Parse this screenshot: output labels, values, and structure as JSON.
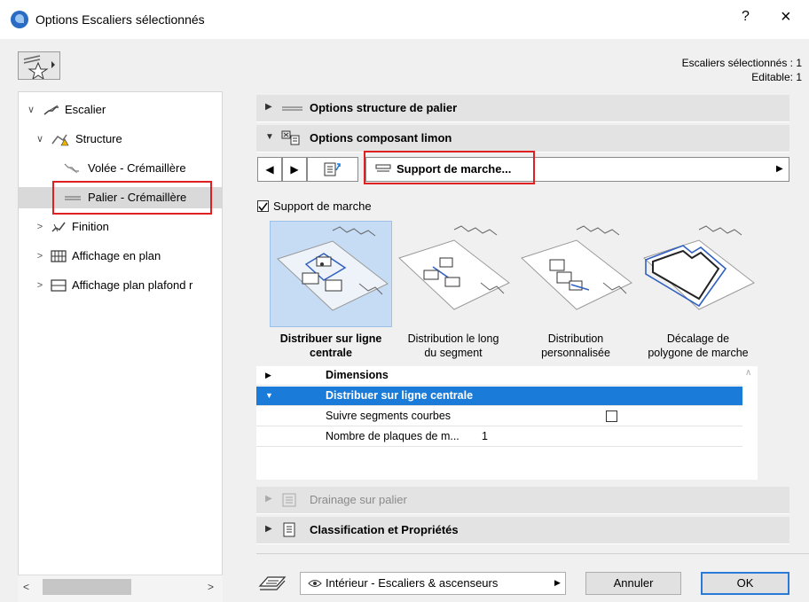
{
  "window": {
    "title": "Options Escaliers sélectionnés",
    "help": "?",
    "close": "×"
  },
  "status": {
    "selected": "Escaliers sélectionnés : 1",
    "editable": "Editable: 1"
  },
  "tree": {
    "items": [
      {
        "label": "Escalier",
        "twisty": "∨"
      },
      {
        "label": "Structure",
        "twisty": "∨"
      },
      {
        "label": "Volée - Crémaillère"
      },
      {
        "label": "Palier - Crémaillère"
      },
      {
        "label": "Finition",
        "twisty": ">"
      },
      {
        "label": "Affichage en plan",
        "twisty": ">"
      },
      {
        "label": "Affichage plan plafond r",
        "twisty": ">"
      }
    ]
  },
  "sections": {
    "structure": "Options structure de palier",
    "composant": "Options composant limon",
    "drainage": "Drainage sur palier",
    "classification": "Classification et Propriétés"
  },
  "nav": {
    "prev": "◀",
    "next": "▶",
    "field": "Support de marche..."
  },
  "support": {
    "checkbox_label": "Support de marche",
    "checked": true,
    "options": [
      {
        "label_line1": "Distribuer sur ligne",
        "label_line2": "centrale",
        "selected": true
      },
      {
        "label_line1": "Distribution le long",
        "label_line2": "du segment",
        "selected": false
      },
      {
        "label_line1": "Distribution",
        "label_line2": "personnalisée",
        "selected": false
      },
      {
        "label_line1": "Décalage de",
        "label_line2": "polygone de marche",
        "selected": false
      }
    ]
  },
  "grid": {
    "rows": [
      {
        "label": "Dimensions",
        "value": ""
      },
      {
        "label": "Distribuer sur ligne centrale",
        "value": ""
      },
      {
        "label": "Suivre segments courbes",
        "value": ""
      },
      {
        "label": "Nombre de plaques de m...",
        "value": "1"
      }
    ]
  },
  "footer": {
    "view": "Intérieur - Escaliers & ascenseurs",
    "cancel": "Annuler",
    "ok": "OK"
  },
  "colors": {
    "accent": "#1a7bd8",
    "highlight": "#e02020",
    "selected_bg": "#c5dcf4"
  }
}
